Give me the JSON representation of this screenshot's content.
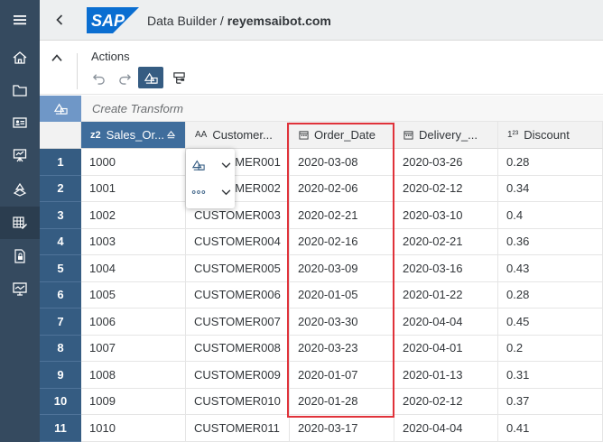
{
  "shell": {
    "title_prefix": "Data Builder / ",
    "workspace": "reyemsaibot.com",
    "logo_text": "SAP",
    "colors": {
      "shell_bg": "#edeff0",
      "rail_bg": "#354a5f",
      "accent": "#355c82",
      "logo_blue": "#0a6ed1"
    }
  },
  "nav": [
    "home-icon",
    "folder-icon",
    "id-card-icon",
    "presentation-icon",
    "data-flow-icon",
    "table-editor-icon",
    "secure-doc-icon",
    "monitor-icon"
  ],
  "toolbar": {
    "actions_label": "Actions",
    "buttons": [
      "undo-icon",
      "redo-icon",
      "transform-icon",
      "structure-icon"
    ]
  },
  "transform": {
    "placeholder": "Create Transform"
  },
  "table": {
    "columns": [
      {
        "label": "Sales_Or...",
        "type": "z2"
      },
      {
        "label": "Customer...",
        "type": "AA"
      },
      {
        "label": "Order_Date",
        "type": "calendar"
      },
      {
        "label": "Delivery_...",
        "type": "calendar"
      },
      {
        "label": "Discount",
        "type": "1.23"
      }
    ],
    "rows": [
      {
        "n": "1",
        "cells": [
          "1000",
          "CUSTOMER001",
          "2020-03-08",
          "2020-03-26",
          "0.28"
        ]
      },
      {
        "n": "2",
        "cells": [
          "1001",
          "CUSTOMER002",
          "2020-02-06",
          "2020-02-12",
          "0.34"
        ]
      },
      {
        "n": "3",
        "cells": [
          "1002",
          "CUSTOMER003",
          "2020-02-21",
          "2020-03-10",
          "0.4"
        ]
      },
      {
        "n": "4",
        "cells": [
          "1003",
          "CUSTOMER004",
          "2020-02-16",
          "2020-02-21",
          "0.36"
        ]
      },
      {
        "n": "5",
        "cells": [
          "1004",
          "CUSTOMER005",
          "2020-03-09",
          "2020-03-16",
          "0.43"
        ]
      },
      {
        "n": "6",
        "cells": [
          "1005",
          "CUSTOMER006",
          "2020-01-05",
          "2020-01-22",
          "0.28"
        ]
      },
      {
        "n": "7",
        "cells": [
          "1006",
          "CUSTOMER007",
          "2020-03-30",
          "2020-04-04",
          "0.45"
        ]
      },
      {
        "n": "8",
        "cells": [
          "1007",
          "CUSTOMER008",
          "2020-03-23",
          "2020-04-01",
          "0.2"
        ]
      },
      {
        "n": "9",
        "cells": [
          "1008",
          "CUSTOMER009",
          "2020-01-07",
          "2020-01-13",
          "0.31"
        ]
      },
      {
        "n": "10",
        "cells": [
          "1009",
          "CUSTOMER010",
          "2020-01-28",
          "2020-02-12",
          "0.37"
        ]
      },
      {
        "n": "11",
        "cells": [
          "1010",
          "CUSTOMER011",
          "2020-03-17",
          "2020-04-04",
          "0.41"
        ]
      }
    ]
  },
  "popover": {
    "items": [
      "transform-icon",
      "more-icon"
    ]
  }
}
